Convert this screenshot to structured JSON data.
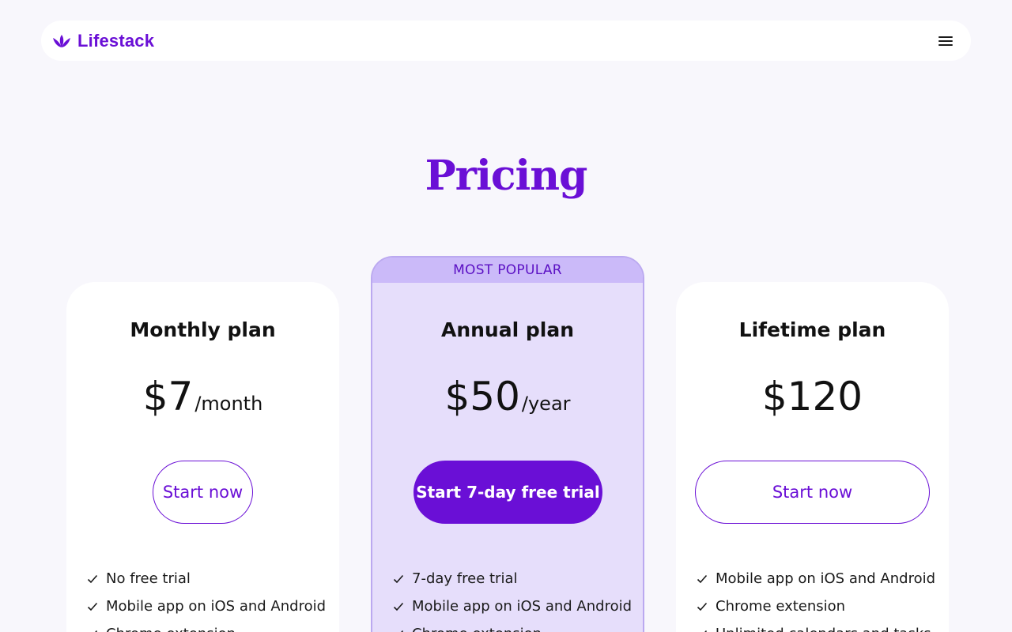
{
  "nav": {
    "brand": "Lifestack",
    "brand_icon": "lotus-logo-icon",
    "menu_icon": "hamburger-menu-icon"
  },
  "page": {
    "title": "Pricing"
  },
  "colors": {
    "brand": "#6a0fd6",
    "annual_card_bg": "#e6defb",
    "popular_banner_bg": "#cbbaf9"
  },
  "plans": [
    {
      "name": "Monthly plan",
      "price": "$7",
      "period": "/month",
      "cta": "Start now",
      "features": [
        "No free trial",
        "Mobile app on iOS and Android",
        "Chrome extension"
      ]
    },
    {
      "badge": "MOST POPULAR",
      "name": "Annual plan",
      "price": "$50",
      "period": "/year",
      "cta": "Start 7-day free trial",
      "features": [
        "7-day free trial",
        "Mobile app on iOS and Android",
        "Chrome extension"
      ]
    },
    {
      "name": "Lifetime plan",
      "price": "$120",
      "period": "",
      "cta": "Start now",
      "features": [
        "Mobile app on iOS and Android",
        "Chrome extension",
        "Unlimited calendars and tasks"
      ]
    }
  ]
}
